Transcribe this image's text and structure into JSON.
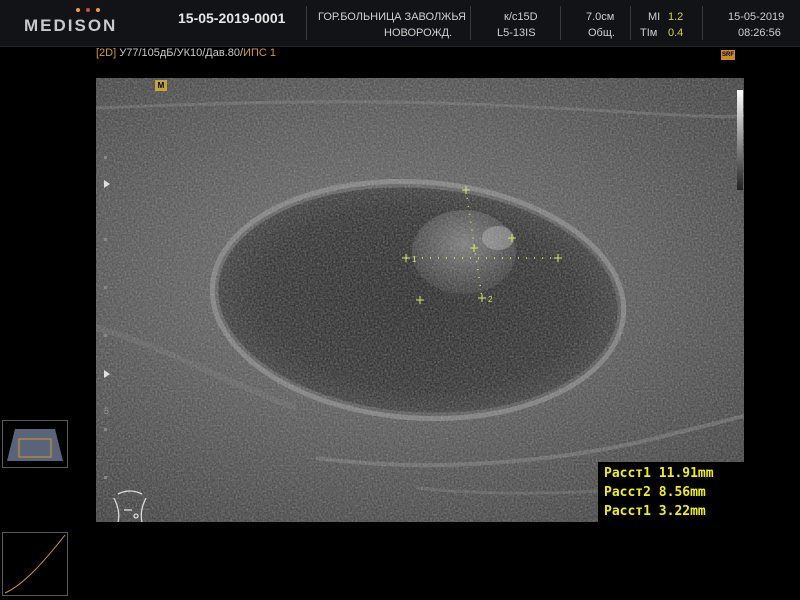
{
  "header": {
    "brand": "MEDISON",
    "brand_dot_colors": [
      "#e8a33a",
      "#d94a3a",
      "#e8a33a"
    ],
    "patient_id": "15-05-2019-0001",
    "institution": "ГОР.БОЛЬНИЦА ЗАВОЛЖЬЯ",
    "department": "НОВОРОЖД.",
    "frame_rate": "к/с15D",
    "probe": "L5-13IS",
    "depth": "7.0см",
    "preset": "Общ.",
    "mi_label": "MI",
    "mi_value": "1.2",
    "tim_label": "TIм",
    "tim_value": "0.4",
    "date": "15-05-2019",
    "time": "08:26:56"
  },
  "mode_line": {
    "mode": "[2D]",
    "params": "У77/105дБ/УК10/Дав.80/",
    "ips": "ИПС 1"
  },
  "badges": {
    "srf": "SRF",
    "m": "M"
  },
  "depth_label": "5",
  "calipers": {
    "c1": "1",
    "c2": "2"
  },
  "measurements": [
    "Расст1 11.91mm",
    "Расст2 8.56mm",
    "Расст1 3.22mm"
  ],
  "colors": {
    "caliper": "#d6e85a",
    "measurement_text": "#f2f200",
    "mode_orange": "#d69a2a"
  }
}
